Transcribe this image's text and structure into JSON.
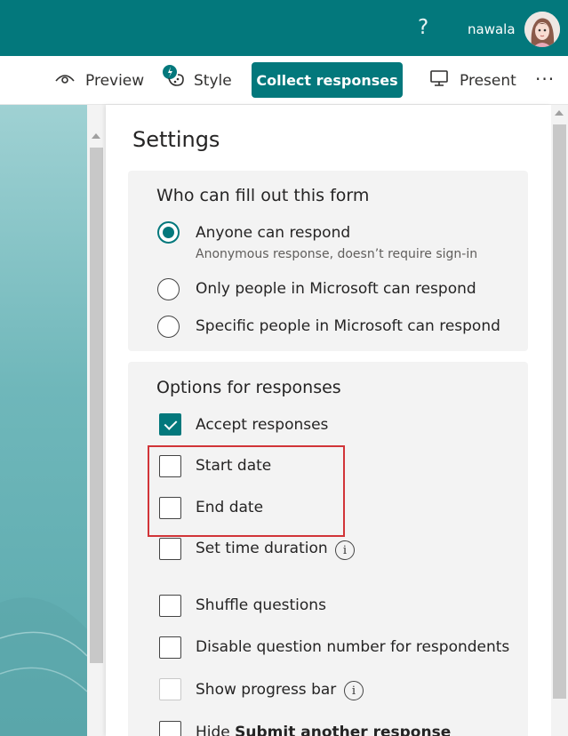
{
  "topbar": {
    "help_label": "?",
    "username": "nawala",
    "accent": "#03787c"
  },
  "toolbar": {
    "preview": "Preview",
    "style": "Style",
    "collect": "Collect responses",
    "present": "Present",
    "more": "···"
  },
  "settings": {
    "title": "Settings",
    "who": {
      "title": "Who can fill out this form",
      "options": [
        {
          "label": "Anyone can respond",
          "sub": "Anonymous response, doesn’t require sign-in",
          "selected": true
        },
        {
          "label": "Only people in Microsoft can respond",
          "selected": false
        },
        {
          "label": "Specific people in Microsoft can respond",
          "selected": false
        }
      ]
    },
    "responses": {
      "title": "Options for responses",
      "options": [
        {
          "label": "Accept responses",
          "checked": true
        },
        {
          "label": "Start date",
          "checked": false
        },
        {
          "label": "End date",
          "checked": false
        },
        {
          "label": "Set time duration",
          "checked": false,
          "info": true
        },
        {
          "label": "Shuffle questions",
          "checked": false
        },
        {
          "label": "Disable question number for respondents",
          "checked": false
        },
        {
          "label": "Show progress bar",
          "checked": false,
          "info": true,
          "disabled": true
        },
        {
          "label_prefix": "Hide ",
          "label_bold": "Submit another response",
          "checked": false
        }
      ]
    },
    "info_icon": "i"
  }
}
